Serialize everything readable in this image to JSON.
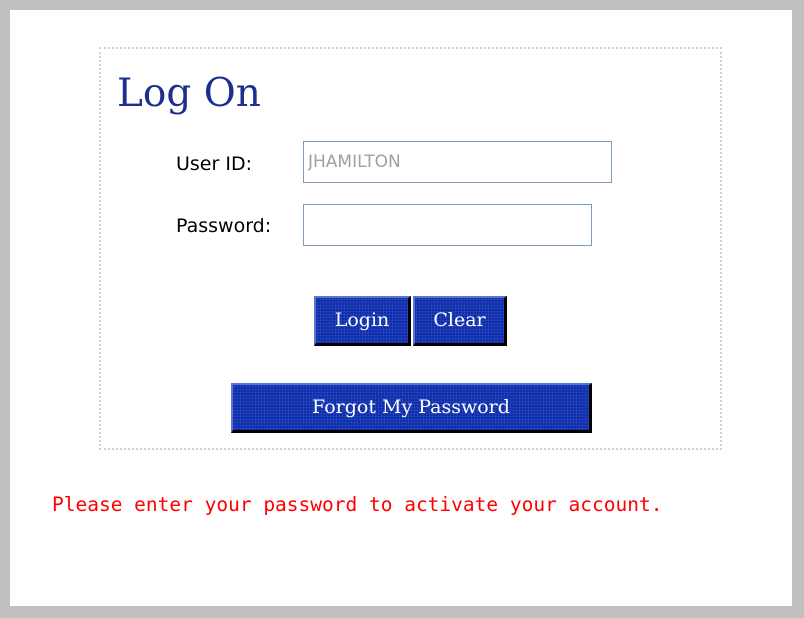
{
  "login_form": {
    "title": "Log On",
    "user_id_label": "User ID:",
    "user_id_value": "JHAMILTON",
    "password_label": "Password:",
    "password_value": "",
    "login_button": "Login",
    "clear_button": "Clear",
    "forgot_password_button": "Forgot My Password"
  },
  "status": {
    "message": "Please enter your password to activate your account."
  },
  "colors": {
    "title": "#1c2f8e",
    "button_bg": "#0f2ea7",
    "button_text": "#ffffff",
    "error_text": "#ff0000",
    "frame": "#c0c0c0",
    "box_border": "#d8d2bc",
    "disabled_input_text": "#a0a0a0"
  }
}
